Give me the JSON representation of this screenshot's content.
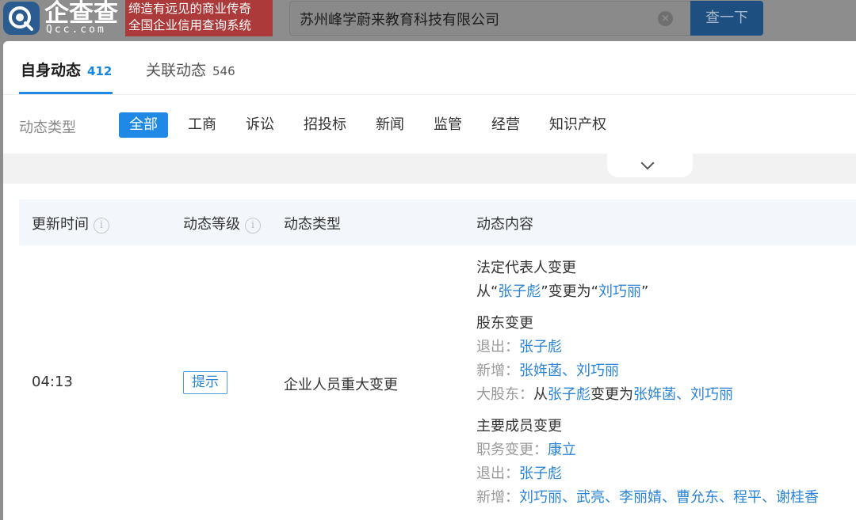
{
  "brand": {
    "name": "企查查",
    "domain": "Qcc.com",
    "slogan_line1": "缔造有远见的商业传奇",
    "slogan_line2": "全国企业信用查询系统"
  },
  "search": {
    "value": "苏州峰学蔚来教育科技有限公司",
    "clear_glyph": "×",
    "button_label": "查一下"
  },
  "tabs": [
    {
      "label": "自身动态",
      "count": "412"
    },
    {
      "label": "关联动态",
      "count": "546"
    }
  ],
  "filter": {
    "label": "动态类型",
    "items": [
      "全部",
      "工商",
      "诉讼",
      "招投标",
      "新闻",
      "监管",
      "经营",
      "知识产权"
    ]
  },
  "table": {
    "headers": [
      "更新时间",
      "动态等级",
      "动态类型",
      "动态内容"
    ],
    "info_glyph": "i",
    "row": {
      "time": "04:13",
      "level": "提示",
      "type": "企业人员重大变更"
    }
  },
  "content": {
    "legal_rep": {
      "title": "法定代表人变更",
      "from_prefix": "从“",
      "from_name": "张子彪",
      "mid": "”变更为“",
      "to_name": "刘巧丽",
      "suffix": "”"
    },
    "shareholder": {
      "title": "股东变更",
      "exit_label": "退出：",
      "exit_names": [
        "张子彪"
      ],
      "add_label": "新增：",
      "add_names": [
        "张姩菡",
        "刘巧丽"
      ],
      "major_label": "大股东：",
      "major_from_prefix": "从",
      "major_from": "张子彪",
      "major_mid": "变更为",
      "major_to": [
        "张姩菡",
        "刘巧丽"
      ]
    },
    "members": {
      "title": "主要成员变更",
      "position_label": "职务变更：",
      "position_names": [
        "康立"
      ],
      "exit_label": "退出：",
      "exit_names": [
        "张子彪"
      ],
      "add_label": "新增：",
      "add_names": [
        "刘巧丽",
        "武亮",
        "李丽婧",
        "曹允东",
        "程平",
        "谢桂香"
      ]
    },
    "separator": "、"
  },
  "colors": {
    "accent": "#1e8ae6",
    "link": "#2a83d6",
    "slogan_bg": "#ac3a3a"
  }
}
